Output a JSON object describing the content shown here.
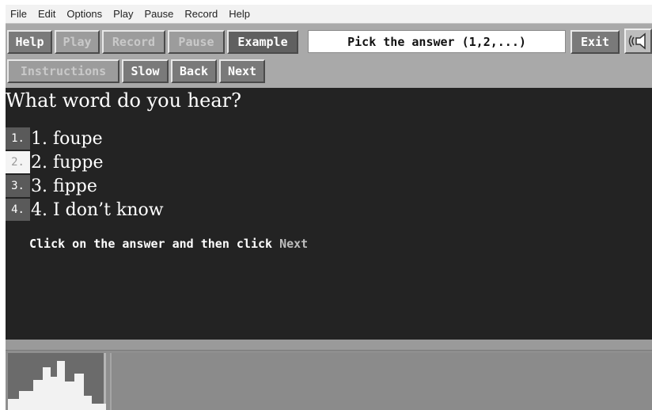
{
  "menubar": {
    "items": [
      "File",
      "Edit",
      "Options",
      "Play",
      "Pause",
      "Record",
      "Help"
    ]
  },
  "toolbar": {
    "help": "Help",
    "play": "Play",
    "record": "Record",
    "pause": "Pause",
    "example": "Example",
    "exit": "Exit"
  },
  "prompt": "Pick the answer (1,2,...)",
  "nav": {
    "instructions": "Instructions",
    "slow": "Slow",
    "back": "Back",
    "next": "Next"
  },
  "question": "What word do you hear?",
  "answers": [
    {
      "num": "1.",
      "label": "1. foupe",
      "selected": false
    },
    {
      "num": "2.",
      "label": "2. fuppe",
      "selected": true
    },
    {
      "num": "3.",
      "label": "3. fippe",
      "selected": false
    },
    {
      "num": "4.",
      "label": "4. I don’t know",
      "selected": false
    }
  ],
  "hint": {
    "text": "Click on the answer and then click",
    "highlight": "Next"
  },
  "icons": {
    "speaker": "speaker-icon"
  },
  "colors": {
    "main_bg": "#232323",
    "toolbar_bg": "#a9a9a9",
    "selected_bg": "#f4f4f4"
  }
}
